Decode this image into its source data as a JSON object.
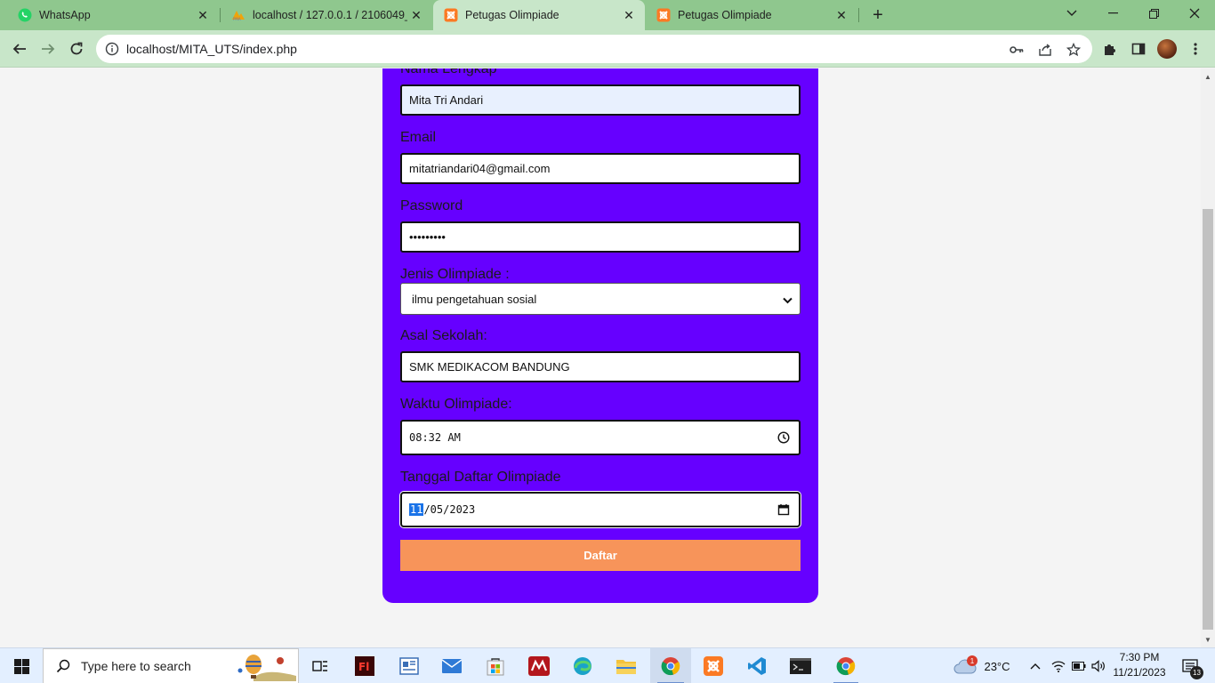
{
  "browser": {
    "tabs": [
      {
        "title": "WhatsApp",
        "icon": "whatsapp-icon",
        "active": false
      },
      {
        "title": "localhost / 127.0.0.1 / 2106049_",
        "icon": "phpmyadmin-icon",
        "active": false
      },
      {
        "title": "Petugas Olimpiade",
        "icon": "xampp-icon",
        "active": true
      },
      {
        "title": "Petugas Olimpiade",
        "icon": "xampp-icon",
        "active": false
      }
    ],
    "url": "localhost/MITA_UTS/index.php"
  },
  "form": {
    "nama_label": "Nama Lengkap",
    "nama_value": "Mita Tri Andari",
    "email_label": "Email",
    "email_value": "mitatriandari04@gmail.com",
    "password_label": "Password",
    "password_value": "•••••••••",
    "jenis_label": "Jenis Olimpiade :",
    "jenis_value": "ilmu pengetahuan sosial",
    "sekolah_label": "Asal Sekolah:",
    "sekolah_value": "SMK MEDIKACOM BANDUNG",
    "waktu_label": "Waktu Olimpiade:",
    "waktu_value": "08:32 AM",
    "tanggal_label": "Tanggal Daftar Olimpiade",
    "tanggal_month": "11",
    "tanggal_rest": "/05/2023",
    "submit_label": "Daftar"
  },
  "taskbar": {
    "search_placeholder": "Type here to search",
    "weather_temp": "23°C",
    "weather_badge": "1",
    "time": "7:30 PM",
    "date": "11/21/2023",
    "notification_count": "13"
  },
  "colors": {
    "card": "#6600ff",
    "button": "#f7945a",
    "chrome_tabstrip": "#8fc78e",
    "chrome_toolbar": "#c8e6c9"
  }
}
